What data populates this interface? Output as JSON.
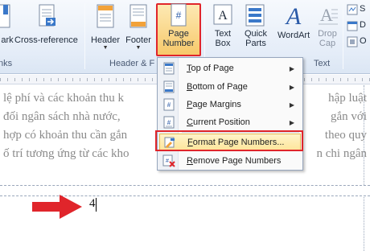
{
  "ribbon": {
    "partial_left_label": "ark",
    "cross_reference_label": "Cross-reference",
    "partial_left_group": "nks",
    "header_label": "Header",
    "footer_label": "Footer",
    "page_number_label_1": "Page",
    "page_number_label_2": "Number",
    "header_footer_group": "Header & F",
    "text_box_label_1": "Text",
    "text_box_label_2": "Box",
    "quick_parts_label_1": "Quick",
    "quick_parts_label_2": "Parts",
    "wordart_label": "WordArt",
    "drop_cap_label_1": "Drop",
    "drop_cap_label_2": "Cap",
    "text_group": "Text",
    "right_icons": [
      "S",
      "D",
      "O"
    ]
  },
  "menu": {
    "items": [
      {
        "label_u": "T",
        "label_rest": "op of Page",
        "icon": "page-top-icon",
        "has_submenu": true
      },
      {
        "label_u": "B",
        "label_rest": "ottom of Page",
        "icon": "page-bottom-icon",
        "has_submenu": true
      },
      {
        "label_u": "P",
        "label_rest": "age Margins",
        "icon": "page-margins-icon",
        "has_submenu": true
      },
      {
        "label_u": "C",
        "label_rest": "urrent Position",
        "icon": "current-position-icon",
        "has_submenu": true
      },
      {
        "label_u": "F",
        "label_rest": "ormat Page Numbers...",
        "icon": "format-page-numbers-icon",
        "has_submenu": false
      },
      {
        "label_u": "R",
        "label_rest": "emove Page Numbers",
        "icon": "remove-page-numbers-icon",
        "has_submenu": false
      }
    ]
  },
  "document": {
    "lines": [
      {
        "left": "lệ phí và các khoản thu k",
        "right": "hập luật"
      },
      {
        "left": "đối ngân sách nhà nước,",
        "right": "gắn với"
      },
      {
        "left": "hợp có khoản thu cần gắn",
        "right": "theo quy"
      },
      {
        "left": "ố trí tương ứng từ các kho",
        "right": "n chi ngân"
      }
    ],
    "page_number": "4"
  },
  "colors": {
    "highlight": "#e0252b",
    "arrow": "#e0252b"
  }
}
